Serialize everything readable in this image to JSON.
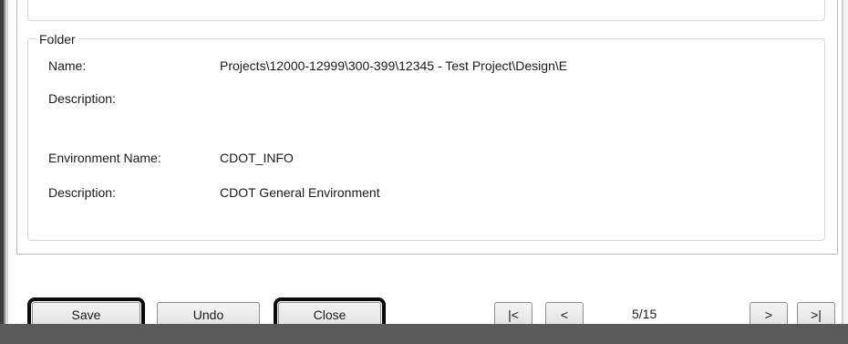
{
  "folder_section": {
    "group_title": "Folder",
    "name_label": "Name:",
    "name_value": "Projects\\12000-12999\\300-399\\12345 - Test Project\\Design\\E",
    "description_label": "Description:",
    "description_value": ""
  },
  "environment_section": {
    "name_label": "Environment Name:",
    "name_value": "CDOT_INFO",
    "description_label": "Description:",
    "description_value": "CDOT General Environment"
  },
  "buttons": {
    "save": "Save",
    "undo": "Undo",
    "close": "Close"
  },
  "navigation": {
    "first": "|<",
    "prev": "<",
    "page": "5/15",
    "next": ">",
    "last": ">|"
  }
}
